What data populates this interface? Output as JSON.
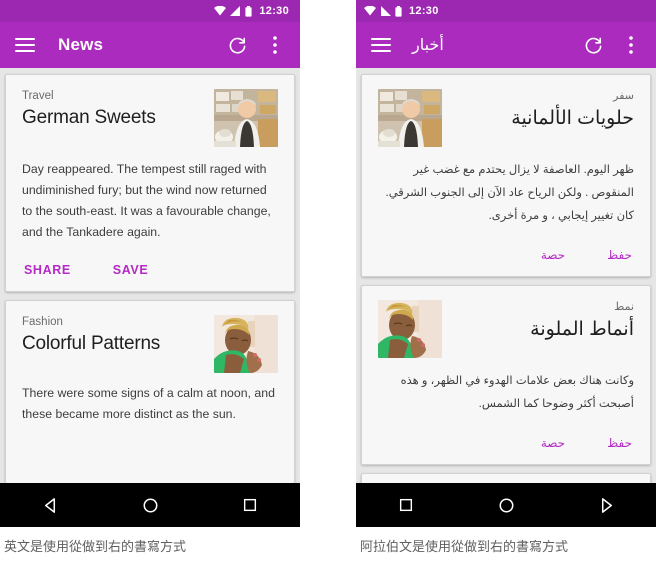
{
  "captions": {
    "left": "英文是使用從做到右的書寫方式",
    "right": "阿拉伯文是使用從做到右的書寫方式"
  },
  "colors": {
    "status_bar": "#9c27b0",
    "app_bar": "#aa2bbd",
    "accent_action": "#b32bc4",
    "card_bg": "#f7f7f7",
    "page_bg": "#e6e6e6",
    "nav_bar": "#000000"
  },
  "phones": [
    {
      "id": "ltr-phone",
      "direction": "ltr",
      "status": {
        "time": "12:30",
        "icons": [
          "wifi-icon",
          "signal-icon",
          "battery-icon"
        ]
      },
      "appbar": {
        "menu_icon": "hamburger-menu-icon",
        "title": "News",
        "refresh_icon": "refresh-icon",
        "overflow_icon": "overflow-menu-icon"
      },
      "cards": [
        {
          "kicker": "Travel",
          "headline": "German Sweets",
          "body": "Day reappeared. The tempest still raged with undiminished fury; but the wind now returned to the south-east. It was a favourable change, and the Tankadere again.",
          "thumbnail": "baker-photo",
          "actions": [
            "SHARE",
            "SAVE"
          ]
        },
        {
          "kicker": "Fashion",
          "headline": "Colorful Patterns",
          "body": "There were some signs of a calm at noon, and these became more distinct as the sun.",
          "thumbnail": "woman-portrait-photo",
          "actions": []
        }
      ],
      "nav": [
        "back-icon",
        "home-icon",
        "recents-icon"
      ]
    },
    {
      "id": "rtl-phone",
      "direction": "rtl",
      "status": {
        "time": "12:30",
        "icons": [
          "battery-icon",
          "signal-icon",
          "wifi-icon"
        ]
      },
      "appbar": {
        "menu_icon": "hamburger-menu-icon",
        "title": "أخبار",
        "refresh_icon": "refresh-icon",
        "overflow_icon": "overflow-menu-icon"
      },
      "cards": [
        {
          "kicker": "سفر",
          "headline": "حلويات الألمانية",
          "body": "ظهر اليوم. العاصفة لا يزال يحتدم مع غضب غير المنقوص . ولكن الرياح عاد الآن إلى الجنوب الشرقي. كان تغيير إيجابي ، و  مرة أخرى.",
          "thumbnail": "baker-photo",
          "actions": [
            "حفظ",
            "حصة"
          ]
        },
        {
          "kicker": "نمط",
          "headline": "أنماط الملونة",
          "body": "وكانت هناك بعض علامات الهدوء في الظهر، و هذه أصبحت أكثر وضوحا كما الشمس.",
          "thumbnail": "woman-portrait-photo",
          "actions": [
            "حفظ",
            "حصة"
          ]
        }
      ],
      "nav": [
        "recents-icon",
        "home-icon",
        "forward-back-icon"
      ]
    }
  ]
}
